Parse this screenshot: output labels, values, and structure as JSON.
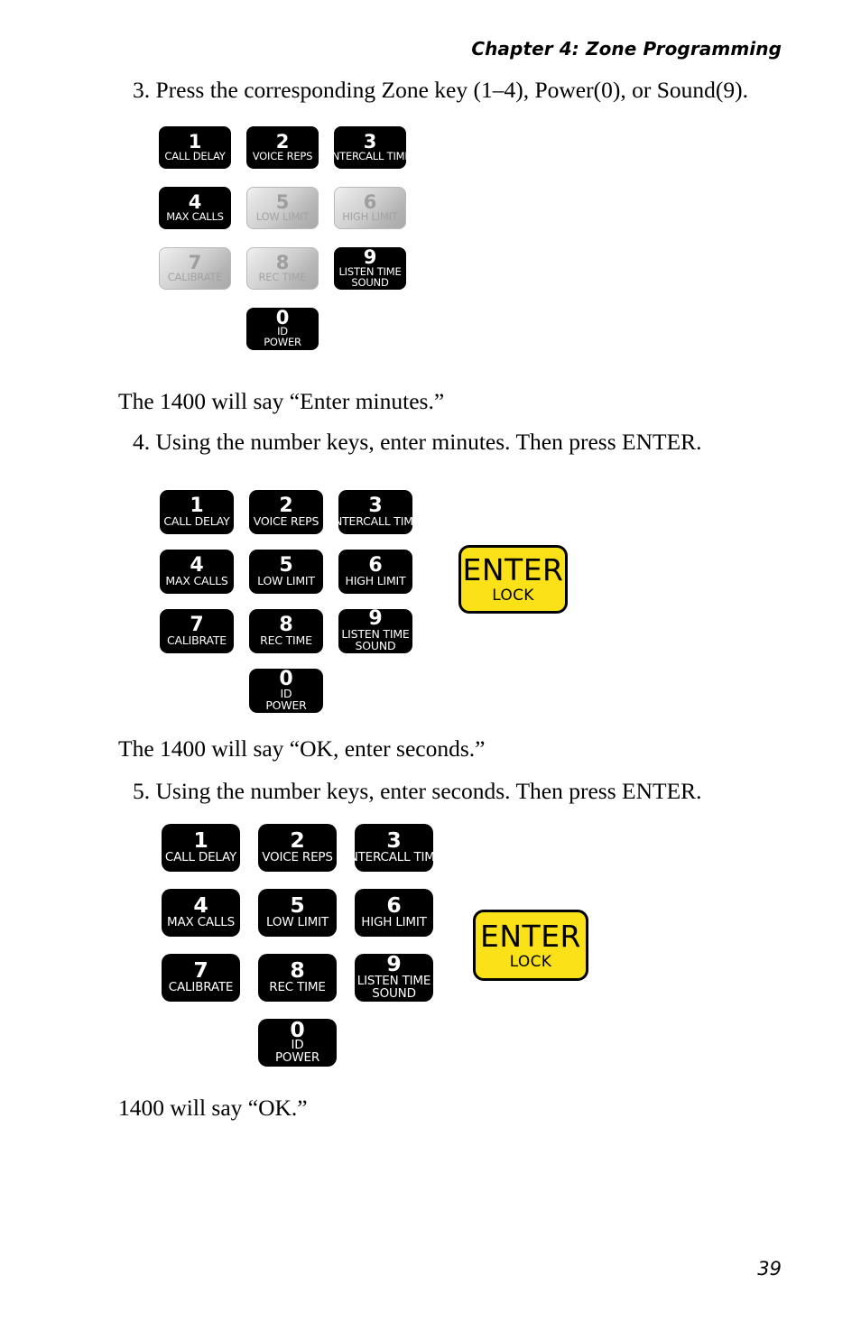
{
  "header": {
    "running_head": "Chapter 4: Zone Programming"
  },
  "footer": {
    "page_number": "39"
  },
  "body": {
    "step3": "3. Press the corresponding Zone key (1–4), Power(0), or Sound(9).",
    "note1": "The 1400 will say “Enter minutes.”",
    "step4": "4. Using the number keys, enter minutes. Then press ENTER.",
    "note2": "The 1400 will say “OK, enter seconds.”",
    "step5": "5. Using the number keys, enter seconds. Then press ENTER.",
    "note3": "1400 will say “OK.”"
  },
  "colors": {
    "key_active_bg": "#000000",
    "key_active_text": "#ffffff",
    "key_disabled_bg": "#cfcfcf",
    "key_disabled_text": "#9e9e9e",
    "enter_bg": "#fbe117",
    "enter_text": "#000000"
  },
  "enter_key": {
    "main_label": "ENTER",
    "sub_label": "LOCK"
  },
  "keypads": [
    {
      "id": "keypad-step3",
      "keys": [
        {
          "digit": "1",
          "label": "CALL DELAY",
          "label2": "",
          "state": "active"
        },
        {
          "digit": "2",
          "label": "VOICE REPS",
          "label2": "",
          "state": "active"
        },
        {
          "digit": "3",
          "label": "INTERCALL TIME",
          "label2": "",
          "state": "active"
        },
        {
          "digit": "4",
          "label": "MAX CALLS",
          "label2": "",
          "state": "active"
        },
        {
          "digit": "5",
          "label": "LOW LIMIT",
          "label2": "",
          "state": "disabled"
        },
        {
          "digit": "6",
          "label": "HIGH LIMIT",
          "label2": "",
          "state": "disabled"
        },
        {
          "digit": "7",
          "label": "CALIBRATE",
          "label2": "",
          "state": "disabled"
        },
        {
          "digit": "8",
          "label": "REC TIME",
          "label2": "",
          "state": "disabled"
        },
        {
          "digit": "9",
          "label": "LISTEN TIME",
          "label2": "SOUND",
          "state": "active"
        },
        {
          "digit": "0",
          "label": "ID",
          "label2": "POWER",
          "state": "active"
        }
      ]
    },
    {
      "id": "keypad-step4",
      "keys": [
        {
          "digit": "1",
          "label": "CALL DELAY",
          "label2": "",
          "state": "active"
        },
        {
          "digit": "2",
          "label": "VOICE REPS",
          "label2": "",
          "state": "active"
        },
        {
          "digit": "3",
          "label": "INTERCALL TIME",
          "label2": "",
          "state": "active"
        },
        {
          "digit": "4",
          "label": "MAX CALLS",
          "label2": "",
          "state": "active"
        },
        {
          "digit": "5",
          "label": "LOW LIMIT",
          "label2": "",
          "state": "active"
        },
        {
          "digit": "6",
          "label": "HIGH LIMIT",
          "label2": "",
          "state": "active"
        },
        {
          "digit": "7",
          "label": "CALIBRATE",
          "label2": "",
          "state": "active"
        },
        {
          "digit": "8",
          "label": "REC TIME",
          "label2": "",
          "state": "active"
        },
        {
          "digit": "9",
          "label": "LISTEN TIME",
          "label2": "SOUND",
          "state": "active"
        },
        {
          "digit": "0",
          "label": "ID",
          "label2": "POWER",
          "state": "active"
        }
      ]
    },
    {
      "id": "keypad-step5",
      "keys": [
        {
          "digit": "1",
          "label": "CALL DELAY",
          "label2": "",
          "state": "active"
        },
        {
          "digit": "2",
          "label": "VOICE REPS",
          "label2": "",
          "state": "active"
        },
        {
          "digit": "3",
          "label": "INTERCALL TIME",
          "label2": "",
          "state": "active"
        },
        {
          "digit": "4",
          "label": "MAX CALLS",
          "label2": "",
          "state": "active"
        },
        {
          "digit": "5",
          "label": "LOW LIMIT",
          "label2": "",
          "state": "active"
        },
        {
          "digit": "6",
          "label": "HIGH LIMIT",
          "label2": "",
          "state": "active"
        },
        {
          "digit": "7",
          "label": "CALIBRATE",
          "label2": "",
          "state": "active"
        },
        {
          "digit": "8",
          "label": "REC TIME",
          "label2": "",
          "state": "active"
        },
        {
          "digit": "9",
          "label": "LISTEN TIME",
          "label2": "SOUND",
          "state": "active"
        },
        {
          "digit": "0",
          "label": "ID",
          "label2": "POWER",
          "state": "active"
        }
      ]
    }
  ]
}
